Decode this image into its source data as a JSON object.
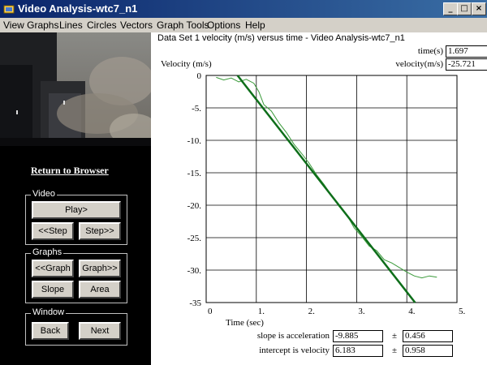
{
  "window": {
    "title": "Video Analysis-wtc7_n1",
    "controls": {
      "minimize": "_",
      "maximize": "□",
      "close": "×"
    }
  },
  "menu": [
    "View Graphs",
    "Lines",
    "Circles",
    "Vectors",
    "Graph Tools",
    "Options",
    "Help"
  ],
  "left_panel": {
    "return_link": "Return to Browser",
    "video_group": {
      "legend": "Video",
      "play": "Play>",
      "step_back": "<<Step",
      "step_forward": "Step>>"
    },
    "graphs_group": {
      "legend": "Graphs",
      "prev_graph": "<<Graph",
      "next_graph": "Graph>>",
      "slope": "Slope",
      "area": "Area"
    },
    "window_group": {
      "legend": "Window",
      "back": "Back",
      "next": "Next"
    }
  },
  "graph_panel": {
    "title": "Data Set 1 velocity (m/s) versus time - Video Analysis-wtc7_n1",
    "time_label": "time(s)",
    "time_value": "1.697",
    "velocity_label": "velocity(m/s)",
    "velocity_value": "-25.721",
    "slope_label": "slope is acceleration",
    "slope_value": "-9.885",
    "slope_pm": "±",
    "slope_error": "0.456",
    "intercept_label": "intercept is velocity",
    "intercept_value": "6.183",
    "intercept_pm": "±",
    "intercept_error": "0.958"
  },
  "chart_data": {
    "type": "line",
    "title": "Data Set 1 velocity (m/s) versus time - Video Analysis-wtc7_n1",
    "xlabel": "Time (sec)",
    "ylabel": "Velocity (m/s)",
    "xlim": [
      0,
      5
    ],
    "ylim": [
      -35,
      0
    ],
    "grid": true,
    "x_ticks": [
      "0",
      "1.",
      "2.",
      "3.",
      "4.",
      "5."
    ],
    "y_ticks": [
      "0",
      "-5.",
      "-10.",
      "-15.",
      "-20.",
      "-25.",
      "-30.",
      "-35"
    ],
    "series": [
      {
        "color": "#3a9a3a",
        "x": [
          0.2,
          0.35,
          0.5,
          0.65,
          0.8,
          0.95,
          1.05,
          1.15,
          1.3,
          1.45,
          1.6,
          1.75,
          1.9,
          2.05,
          2.2,
          2.35,
          2.5,
          2.65,
          2.8,
          2.95,
          3.1,
          3.25,
          3.4,
          3.55,
          3.7,
          3.85,
          4.0,
          4.15,
          4.3,
          4.45,
          4.6
        ],
        "values": [
          -0.3,
          -0.7,
          -0.4,
          -1.0,
          -0.6,
          -1.2,
          -2.5,
          -4.5,
          -5.5,
          -7.3,
          -8.8,
          -10.6,
          -12.0,
          -13.5,
          -15.3,
          -16.8,
          -18.5,
          -20.2,
          -21.4,
          -23.5,
          -24.8,
          -26.3,
          -27.0,
          -28.4,
          -28.9,
          -29.6,
          -30.3,
          -30.9,
          -31.2,
          -30.9,
          -31.1
        ]
      },
      {
        "color": "#0e6e1a",
        "x": [
          0.625,
          4.165
        ],
        "values": [
          0,
          -35
        ]
      }
    ]
  }
}
